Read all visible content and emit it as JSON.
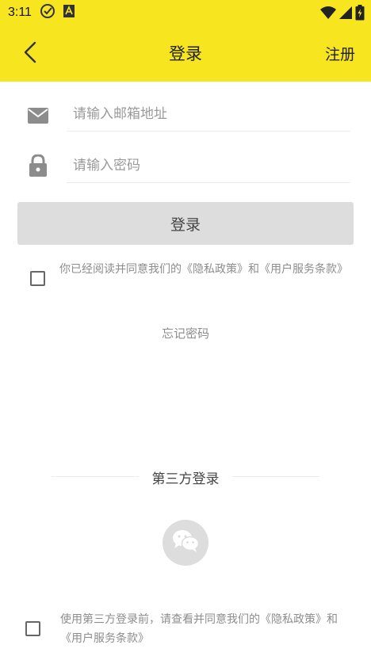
{
  "status": {
    "time": "3:11"
  },
  "nav": {
    "title": "登录",
    "register_label": "注册"
  },
  "form": {
    "email_placeholder": "请输入邮箱地址",
    "password_placeholder": "请输入密码",
    "login_label": "登录"
  },
  "agreement": {
    "text": "你已经阅读并同意我们的《隐私政策》和《用户服务条款》",
    "checked": false
  },
  "forgot_label": "忘记密码",
  "third_party": {
    "title": "第三方登录",
    "agreement_text": "使用第三方登录前，请查看并同意我们的《隐私政策》和《用户服务条款》",
    "checked": false
  },
  "colors": {
    "header_bg": "#f7e61f",
    "button_bg": "#dddddd"
  },
  "icons": {
    "back": "chevron-left-icon",
    "email": "mail-icon",
    "password": "lock-icon",
    "wechat": "wechat-icon"
  }
}
